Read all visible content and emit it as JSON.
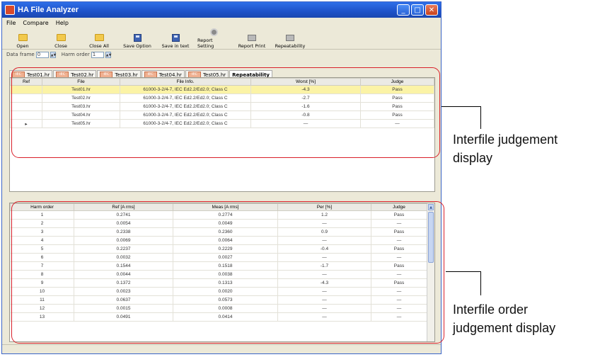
{
  "window": {
    "title": "HA File Analyzer",
    "controls": [
      "_",
      "□",
      "✕"
    ]
  },
  "menu": [
    "File",
    "Compare",
    "Help"
  ],
  "toolbar": [
    {
      "label": "Open",
      "icon": "folder-open-icon"
    },
    {
      "label": "Close",
      "icon": "folder-close-icon"
    },
    {
      "label": "Close All",
      "icon": "folder-close-all-icon"
    },
    {
      "label": "Save Option",
      "icon": "save-option-icon"
    },
    {
      "label": "Save in text",
      "icon": "save-text-icon"
    },
    {
      "label": "Report Setting",
      "icon": "report-setting-icon"
    },
    {
      "label": "Report Print",
      "icon": "report-print-icon"
    },
    {
      "label": "Repeatability",
      "icon": "repeatability-icon"
    }
  ],
  "params": {
    "data_frame_label": "Data frame",
    "data_frame_value": "0",
    "harm_order_label": "Harm order",
    "harm_order_value": "1"
  },
  "tabs": [
    {
      "tag": "IEC",
      "label": "Test01.hr"
    },
    {
      "tag": "IEC",
      "label": "Test02.hr"
    },
    {
      "tag": "IEC",
      "label": "Test03.hr"
    },
    {
      "tag": "IEC",
      "label": "Test04.hr"
    },
    {
      "tag": "IEC",
      "label": "Test05.hr"
    },
    {
      "tag": "",
      "label": "Repeatability"
    }
  ],
  "file_table": {
    "headers": [
      "Ref",
      "File",
      "File Info.",
      "Worst [%]",
      "Judge"
    ],
    "rows": [
      [
        "",
        "Test01.hr",
        "61000-3-2/4-7, IEC Ed2.2/Ed2.0; Class C",
        "-4.3",
        "Pass"
      ],
      [
        "",
        "Test02.hr",
        "61000-3-2/4-7, IEC Ed2.2/Ed2.0; Class C",
        "-2.7",
        "Pass"
      ],
      [
        "",
        "Test03.hr",
        "61000-3-2/4-7, IEC Ed2.2/Ed2.0; Class C",
        "-1.6",
        "Pass"
      ],
      [
        "",
        "Test04.hr",
        "61000-3-2/4-7, IEC Ed2.2/Ed2.0; Class C",
        "-0.8",
        "Pass"
      ],
      [
        "▸",
        "Test05.hr",
        "61000-3-2/4-7, IEC Ed2.2/Ed2.0; Class C",
        "—",
        "—"
      ]
    ]
  },
  "order_table": {
    "headers": [
      "Harm order",
      "Ref [A rms]",
      "Meas [A rms]",
      "Per [%]",
      "Judge"
    ],
    "rows": [
      [
        "1",
        "0.2741",
        "0.2774",
        "1.2",
        "Pass"
      ],
      [
        "2",
        "0.0054",
        "0.0049",
        "—",
        "—"
      ],
      [
        "3",
        "0.2338",
        "0.2360",
        "0.9",
        "Pass"
      ],
      [
        "4",
        "0.0069",
        "0.0064",
        "—",
        "—"
      ],
      [
        "5",
        "0.2237",
        "0.2229",
        "-0.4",
        "Pass"
      ],
      [
        "6",
        "0.0032",
        "0.0027",
        "—",
        "—"
      ],
      [
        "7",
        "0.1544",
        "0.1518",
        "-1.7",
        "Pass"
      ],
      [
        "8",
        "0.0044",
        "0.0038",
        "—",
        "—"
      ],
      [
        "9",
        "0.1372",
        "0.1313",
        "-4.3",
        "Pass"
      ],
      [
        "10",
        "0.0023",
        "0.0020",
        "—",
        "—"
      ],
      [
        "11",
        "0.0637",
        "0.0573",
        "—",
        "—"
      ],
      [
        "12",
        "0.0015",
        "0.0008",
        "—",
        "—"
      ],
      [
        "13",
        "0.0491",
        "0.0414",
        "—",
        "—"
      ]
    ]
  },
  "callouts": {
    "top_line1": "Interfile judgement",
    "top_line2": "display",
    "bottom_line1": "Interfile order",
    "bottom_line2": "judgement display"
  },
  "colors": {
    "highlight_box": "#d9202a",
    "selected_row": "#fbf3a6"
  }
}
